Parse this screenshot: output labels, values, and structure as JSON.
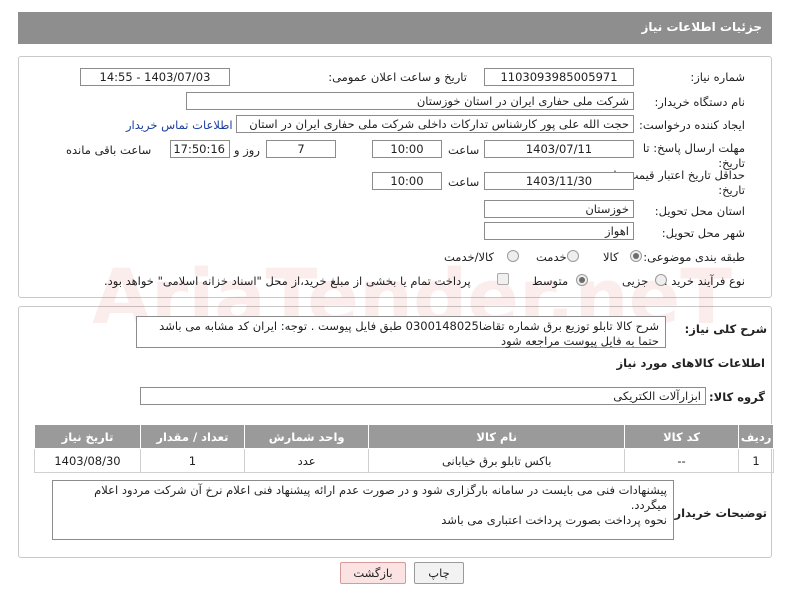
{
  "header": {
    "title": "جزئیات اطلاعات نیاز"
  },
  "need": {
    "number_label": "شماره نیاز:",
    "number": "1103093985005971",
    "announce_label": "تاریخ و ساعت اعلان عمومی:",
    "announce": "1403/07/03 - 14:55",
    "buyer_label": "نام دستگاه خریدار:",
    "buyer": "شرکت ملی حفاری ایران در استان خوزستان",
    "creator_label": "ایجاد کننده درخواست:",
    "creator": "حجت الله علی پور کارشناس تدارکات داخلی شرکت ملی حفاری ایران در استان",
    "contact_link": "اطلاعات تماس خریدار",
    "deadline_label_1": "مهلت ارسال پاسخ: تا",
    "deadline_label_2": "تاریخ:",
    "deadline_date": "1403/07/11",
    "time_label": "ساعت",
    "deadline_time": "10:00",
    "days": "7",
    "days_label": "روز و",
    "remaining": "17:50:16",
    "remaining_label": "ساعت باقی مانده",
    "validity_label_1": "حداقل تاریخ اعتبار قیمت: تا",
    "validity_label_2": "تاریخ:",
    "validity_date": "1403/11/30",
    "validity_time": "10:00",
    "province_label": "استان محل تحویل:",
    "province": "خوزستان",
    "city_label": "شهر محل تحویل:",
    "city": "اهواز",
    "category_label": "طبقه بندی موضوعی:",
    "category_options": [
      "کالا",
      "خدمت",
      "کالا/خدمت"
    ],
    "process_label": "نوع فرآیند خرید :",
    "process_options": [
      "جزیی",
      "متوسط"
    ],
    "payment_note": "پرداخت تمام یا بخشی از مبلغ خرید،از محل \"اسناد خزانه اسلامی\" خواهد بود."
  },
  "description": {
    "label": "شرح کلی نیاز:",
    "text": "شرح کالا تابلو توزیع برق شماره تقاضا0300148025 طبق فایل پیوست . توجه: ایران کد مشابه می باشد حتما به فایل پیوست مراجعه شود"
  },
  "goods": {
    "section_title": "اطلاعات کالاهای مورد نیاز",
    "group_label": "گروه کالا:",
    "group": "ابزارآلات الکتریکی",
    "columns": [
      "ردیف",
      "کد کالا",
      "نام کالا",
      "واحد شمارش",
      "تعداد / مقدار",
      "تاریخ نیاز"
    ],
    "rows": [
      {
        "row": "1",
        "code": "--",
        "name": "باکس تابلو برق خیابانی",
        "unit": "عدد",
        "qty": "1",
        "date": "1403/08/30"
      }
    ]
  },
  "buyer_notes": {
    "label": "توضیحات خریدار:",
    "line1": "پیشنهادات فنی می بایست در سامانه بارگزاری شود و در صورت عدم ارائه پیشنهاد فنی اعلام نرخ آن شرکت مردود اعلام میگردد.",
    "line2": "نحوه پرداخت بصورت پرداخت اعتباری می باشد"
  },
  "buttons": {
    "print": "چاپ",
    "back": "بازگشت"
  },
  "watermark": "AriaTender.neT",
  "colors": {
    "header_bg": "#8e8e8e",
    "link": "#1a3e9e",
    "back_button_bg": "#fbe3e3"
  }
}
